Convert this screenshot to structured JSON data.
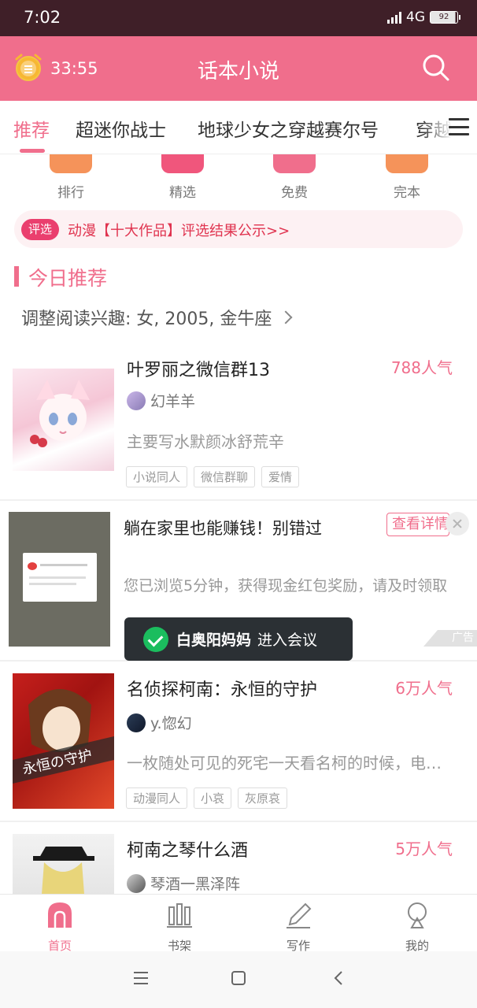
{
  "status_bar": {
    "time": "7:02",
    "network": "4G",
    "battery": "92"
  },
  "header": {
    "timer": "33:55",
    "title": "话本小说",
    "icons": [
      "alarm-icon",
      "search-icon"
    ]
  },
  "tabs": {
    "items": [
      "推荐",
      "超迷你战士",
      "地球少女之穿越赛尔号",
      "穿越"
    ],
    "active": "推荐"
  },
  "categories": [
    {
      "label": "排行",
      "color": "#f5935a"
    },
    {
      "label": "精选",
      "color": "#f0567c"
    },
    {
      "label": "免费",
      "color": "#f06e8c"
    },
    {
      "label": "完本",
      "color": "#f5935a"
    }
  ],
  "banner": {
    "tag": "评选",
    "text": "动漫【十大作品】评选结果公示>>"
  },
  "section": {
    "title": "今日推荐",
    "interest": "调整阅读兴趣: 女, 2005, 金牛座"
  },
  "books": [
    {
      "title": "叶罗丽之微信群13",
      "popularity": "788人气",
      "author": "幻羊羊",
      "desc": "主要写水默颜冰舒荒辛",
      "tags": [
        "小说同人",
        "微信群聊",
        "爱情"
      ]
    },
    {
      "title": "名侦探柯南：永恒的守护",
      "popularity": "6万人气",
      "author": "y.惚幻",
      "desc": "一枚随处可见的死宅一天看名柯的时候，电…",
      "tags": [
        "动漫同人",
        "小哀",
        "灰原哀"
      ],
      "cover_text": "永恒の守护"
    },
    {
      "title": "柯南之琴什么酒",
      "popularity": "5万人气",
      "author": "琴酒一黑泽阵"
    }
  ],
  "ad": {
    "title": "躺在家里也能赚钱！别错过",
    "detail_button": "查看详情",
    "desc": "您已浏览5分钟，获得现金红包奖励，请及时领取",
    "badge": "广告"
  },
  "toast": {
    "name": "白奥阳妈妈",
    "action": "进入会议"
  },
  "bottom_nav": [
    {
      "label": "首页",
      "icon": "home-icon",
      "active": true
    },
    {
      "label": "书架",
      "icon": "bookshelf-icon"
    },
    {
      "label": "写作",
      "icon": "pen-icon"
    },
    {
      "label": "我的",
      "icon": "profile-icon"
    }
  ],
  "colors": {
    "accent": "#f06e8c",
    "status_bar": "#3f1f28"
  }
}
